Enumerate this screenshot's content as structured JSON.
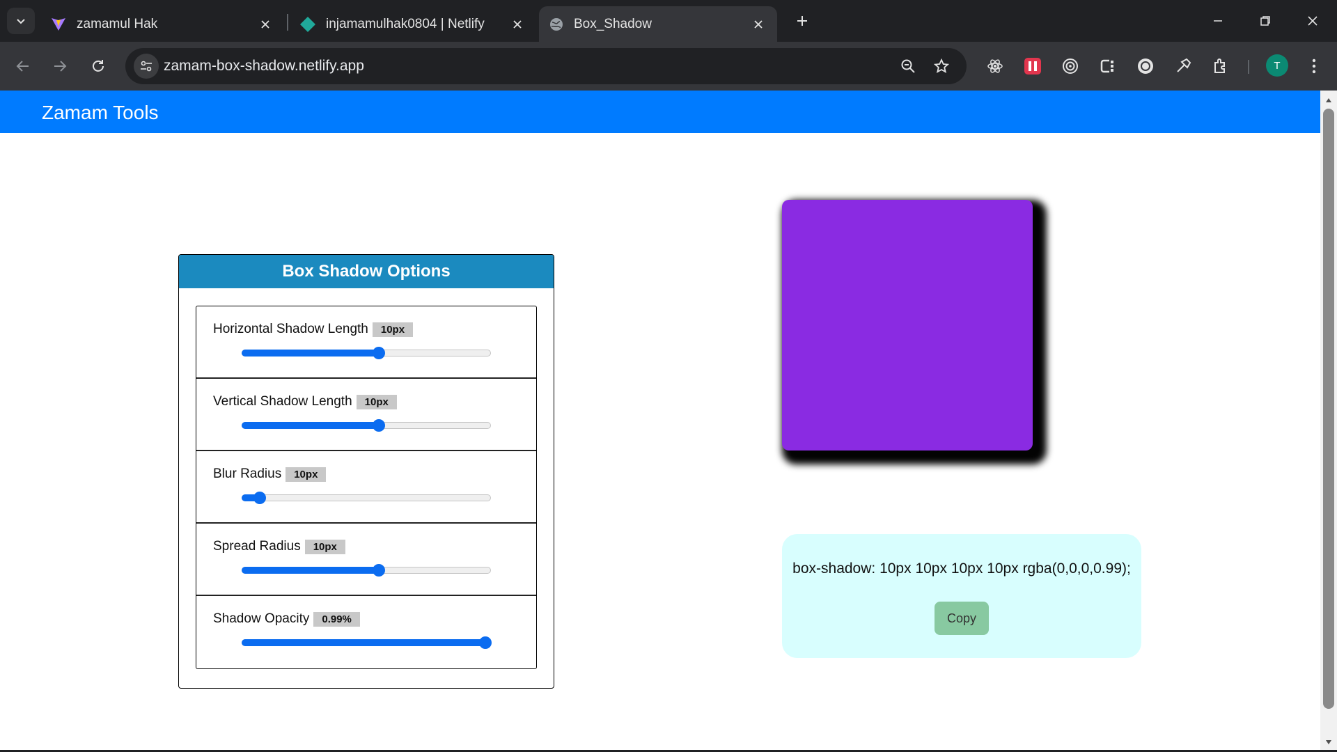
{
  "browser": {
    "tabs": [
      {
        "title": "zamamul Hak",
        "icon": "vite-logo-icon",
        "active": false
      },
      {
        "title": "injamamulhak0804 | Netlify",
        "icon": "netlify-logo-icon",
        "active": false
      },
      {
        "title": "Box_Shadow",
        "icon": "globe-icon",
        "active": true
      }
    ],
    "url": "zamam-box-shadow.netlify.app",
    "avatar_letter": "T"
  },
  "header": {
    "brand": "Zamam Tools"
  },
  "options": {
    "title": "Box Shadow Options",
    "controls": [
      {
        "label": "Horizontal Shadow Length",
        "value": "10px",
        "fraction": 0.55
      },
      {
        "label": "Vertical Shadow Length",
        "value": "10px",
        "fraction": 0.55
      },
      {
        "label": "Blur Radius",
        "value": "10px",
        "fraction": 0.07
      },
      {
        "label": "Spread Radius",
        "value": "10px",
        "fraction": 0.55
      },
      {
        "label": "Shadow Opacity",
        "value": "0.99%",
        "fraction": 0.98
      }
    ]
  },
  "preview": {
    "box_color": "#8a2be2"
  },
  "output": {
    "css": "box-shadow: 10px 10px 10px 10px rgba(0,0,0,0.99);",
    "copy_label": "Copy"
  },
  "colors": {
    "header": "#007bff",
    "panel_head": "#1b8abf",
    "slider": "#0b6cf0",
    "code_card": "#d8fefe",
    "copy_button": "#88c9a1"
  }
}
